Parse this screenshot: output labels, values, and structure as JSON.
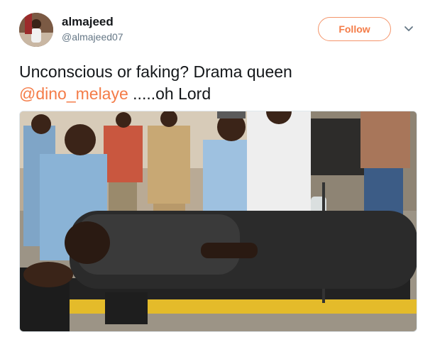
{
  "user": {
    "display_name": "almajeed",
    "handle": "@almajeed07"
  },
  "follow_button": {
    "label": "Follow"
  },
  "tweet": {
    "text_before": "Unconscious or faking? Drama queen",
    "mention": "@dino_melaye",
    "text_after": " .....oh Lord"
  },
  "colors": {
    "accent": "#f47c48",
    "text": "#14171a",
    "muted": "#657786"
  },
  "icons": {
    "menu": "chevron-down-icon"
  }
}
